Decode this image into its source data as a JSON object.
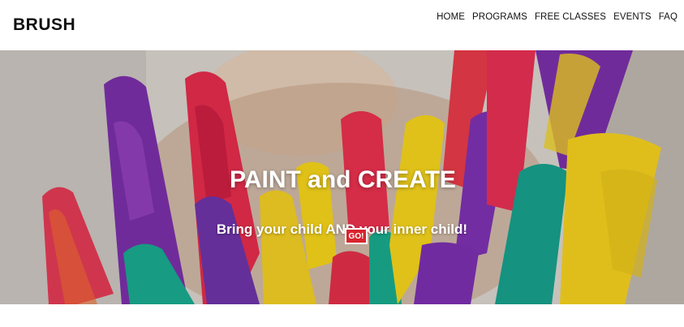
{
  "brand": {
    "name": "BRUSH"
  },
  "nav": {
    "items": [
      {
        "label": "HOME"
      },
      {
        "label": "PROGRAMS"
      },
      {
        "label": "FREE CLASSES"
      },
      {
        "label": "EVENTS"
      },
      {
        "label": "FAQ"
      }
    ]
  },
  "hero": {
    "title": "PAINT and CREATE",
    "subtitle": "Bring your child AND your inner child!",
    "cta_label": "GO!",
    "cta_color": "#d8252e",
    "image_description_icon": "painted-hands-image"
  }
}
